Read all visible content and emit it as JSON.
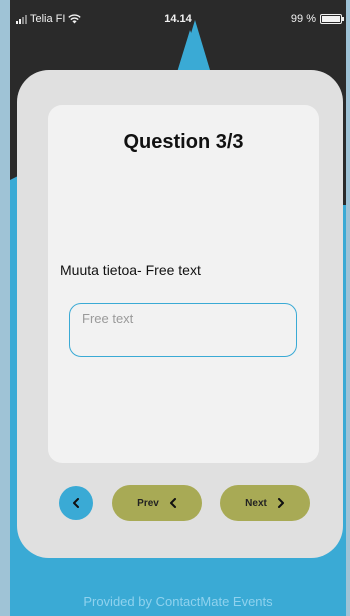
{
  "statusbar": {
    "carrier": "Telia FI",
    "time": "14.14",
    "battery": "99 %",
    "battery_level": 0.99
  },
  "question": {
    "title": "Question 3/3",
    "label": "Muuta tietoa- Free text",
    "input_placeholder": "Free text",
    "input_value": ""
  },
  "nav": {
    "prev_label": "Prev",
    "next_label": "Next"
  },
  "footer": {
    "text": "Provided by ContactMate Events"
  },
  "colors": {
    "accent_blue": "#3aaad5",
    "button_olive": "#a8aa55",
    "dark_bg": "#2a2a2a",
    "card": "#e0e0e0",
    "inner_card": "#f2f2f2"
  },
  "icons": {
    "back": "chevron-left-icon",
    "prev": "chevron-left-icon",
    "next": "chevron-right-icon",
    "wifi": "wifi-icon",
    "signal": "signal-icon",
    "battery": "battery-icon"
  }
}
